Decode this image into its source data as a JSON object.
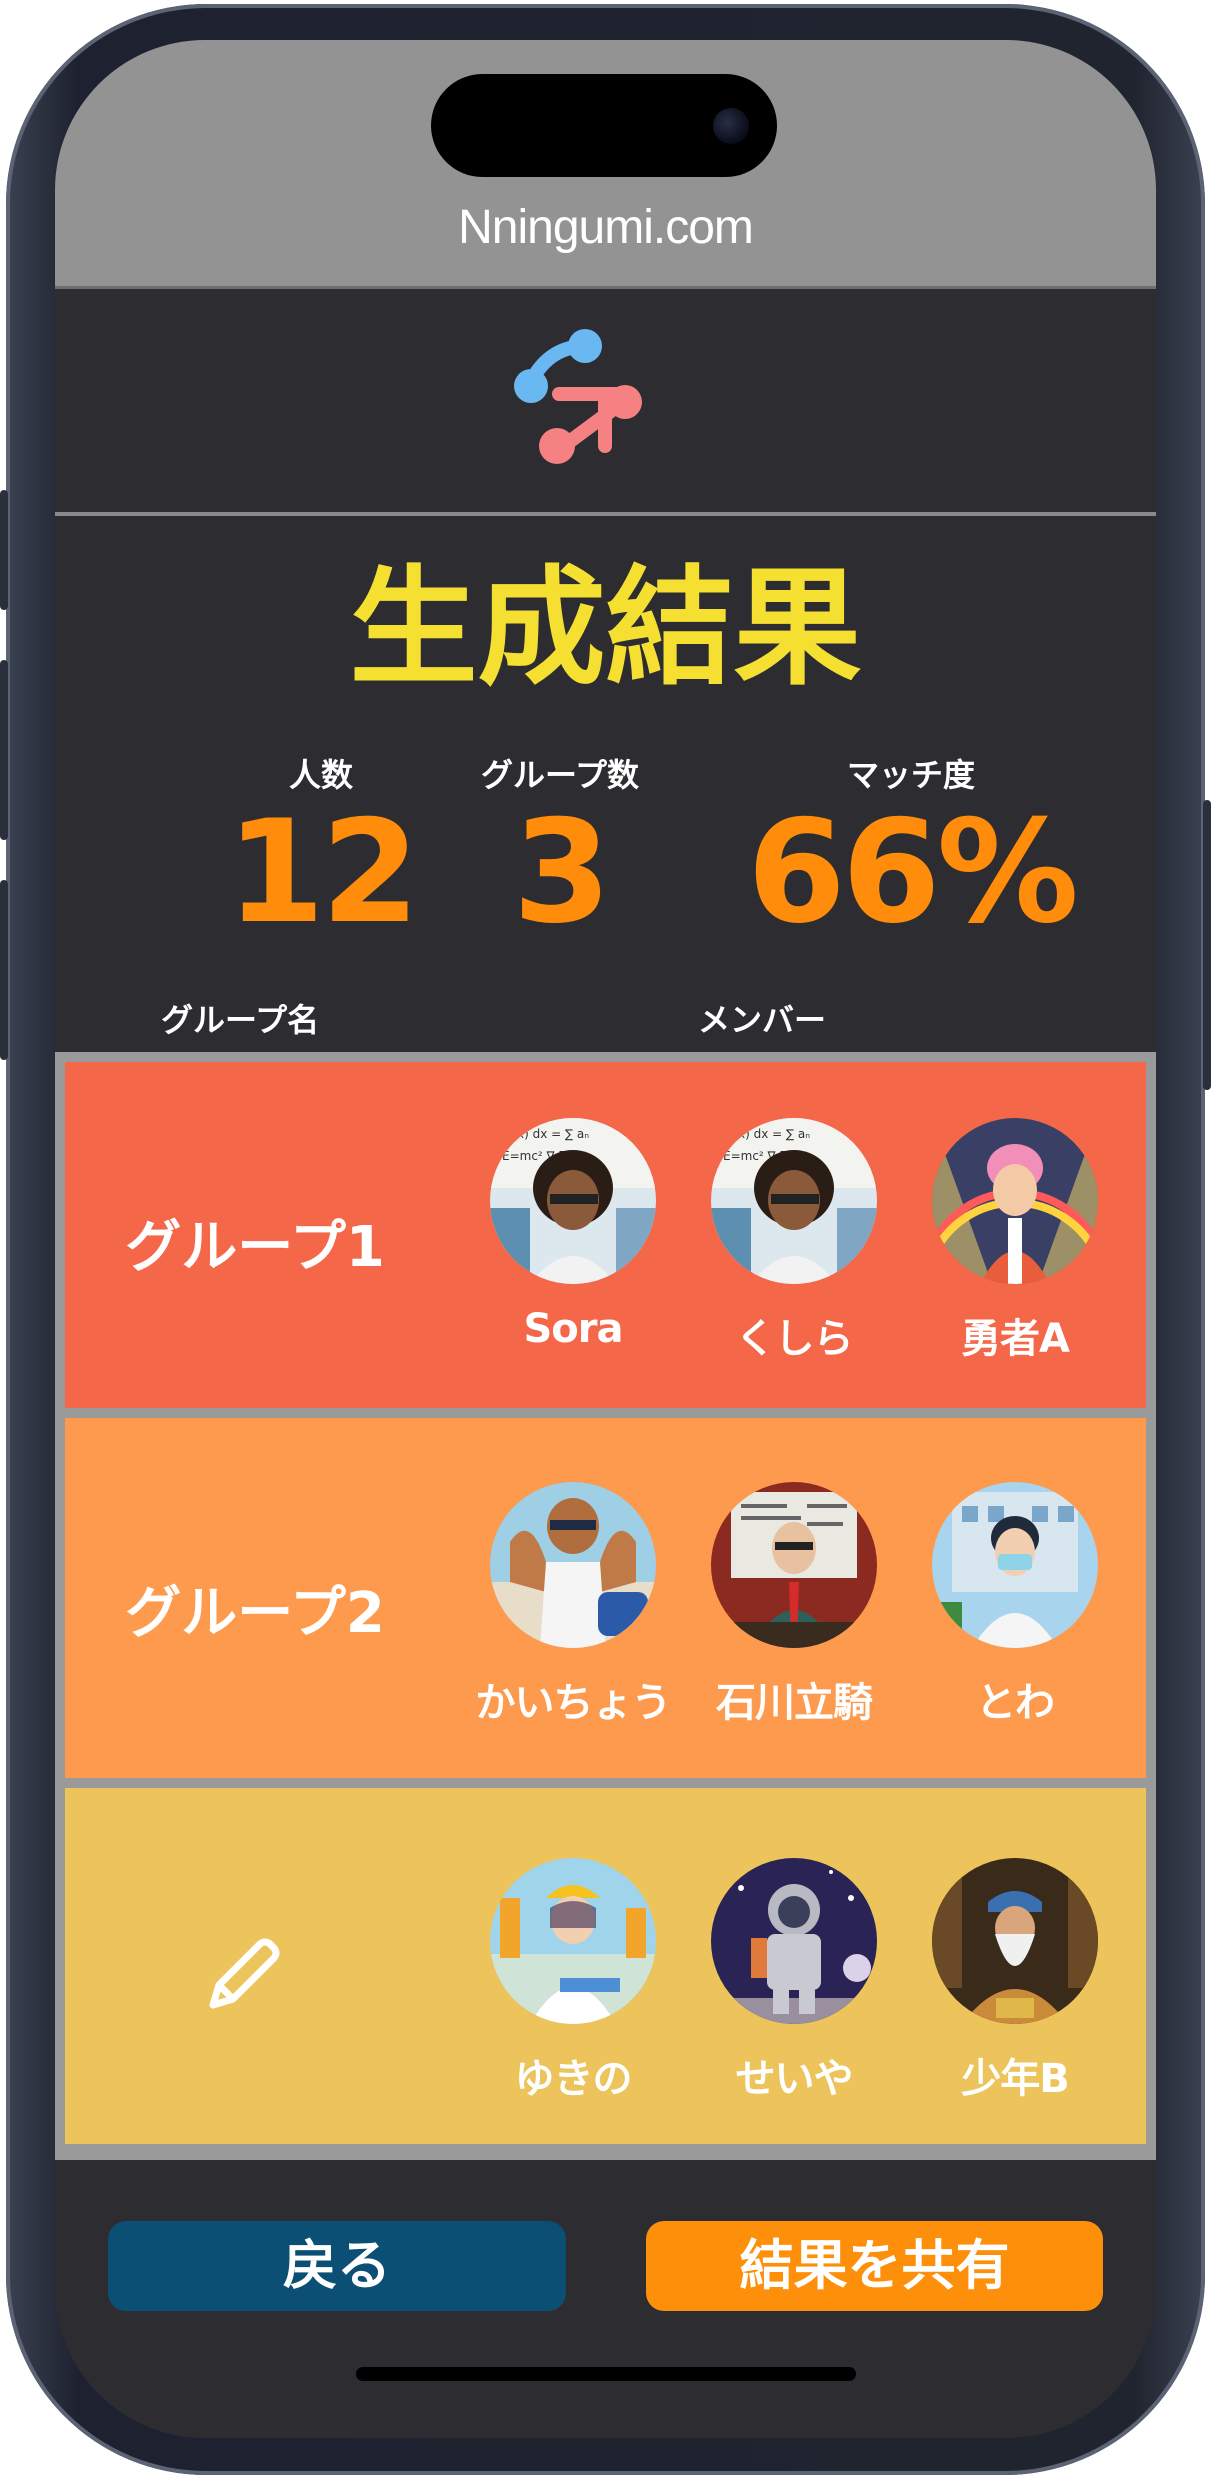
{
  "browser": {
    "site_title": "Nningumi.com"
  },
  "page": {
    "title": "生成結果"
  },
  "stats": [
    {
      "label": "人数",
      "value": "12"
    },
    {
      "label": "グループ数",
      "value": "3"
    },
    {
      "label": "マッチ度",
      "value": "66%"
    }
  ],
  "columns": {
    "group_name": "グループ名",
    "members": "メンバー"
  },
  "groups": [
    {
      "name": "グループ1",
      "color": "#f46849",
      "members": [
        {
          "name": "Sora"
        },
        {
          "name": "くしら"
        },
        {
          "name": "勇者A"
        }
      ]
    },
    {
      "name": "グループ2",
      "color": "#fe9a4e",
      "members": [
        {
          "name": "かいちょう"
        },
        {
          "name": "石川立騎"
        },
        {
          "name": "とわ"
        }
      ]
    },
    {
      "name": "",
      "name_icon": "pencil-icon",
      "color": "#edc35b",
      "members": [
        {
          "name": "ゆきの"
        },
        {
          "name": "せいや"
        },
        {
          "name": "少年B"
        }
      ]
    }
  ],
  "actions": {
    "back_label": "戻る",
    "share_label": "結果を共有"
  },
  "colors": {
    "back_button": "#0c4f75",
    "share_button": "#fd8f0a",
    "title": "#f5e032",
    "stat_value": "#ff8c0a"
  }
}
